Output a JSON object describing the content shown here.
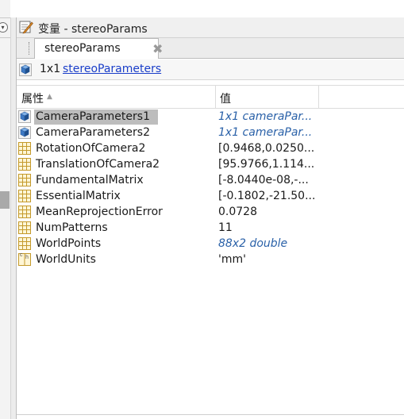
{
  "window": {
    "title": "变量 - stereoParams",
    "title_icon": "pencil-variable-icon"
  },
  "tabs": [
    {
      "label": "stereoParams",
      "close_glyph": "✖"
    }
  ],
  "summary": {
    "icon": "object-cube-icon",
    "size": "1x1",
    "class_name": "stereoParameters"
  },
  "table": {
    "headers": {
      "property": "属性",
      "value": "值"
    },
    "rows": [
      {
        "name": "CameraParameters1",
        "value": "1x1 cameraPar...",
        "icon": "object",
        "kind": "object",
        "selected": true
      },
      {
        "name": "CameraParameters2",
        "value": "1x1 cameraPar...",
        "icon": "object",
        "kind": "object",
        "selected": false
      },
      {
        "name": "RotationOfCamera2",
        "value": "[0.9468,0.0250...",
        "icon": "matrix",
        "kind": "value",
        "selected": false
      },
      {
        "name": "TranslationOfCamera2",
        "value": "[95.9766,1.114...",
        "icon": "matrix",
        "kind": "value",
        "selected": false
      },
      {
        "name": "FundamentalMatrix",
        "value": "[-8.0440e-08,-...",
        "icon": "matrix",
        "kind": "value",
        "selected": false
      },
      {
        "name": "EssentialMatrix",
        "value": "[-0.1802,-21.50...",
        "icon": "matrix",
        "kind": "value",
        "selected": false
      },
      {
        "name": "MeanReprojectionError",
        "value": "0.0728",
        "icon": "matrix",
        "kind": "value",
        "selected": false
      },
      {
        "name": "NumPatterns",
        "value": "11",
        "icon": "matrix",
        "kind": "value",
        "selected": false
      },
      {
        "name": "WorldPoints",
        "value": "88x2 double",
        "icon": "matrix",
        "kind": "object",
        "selected": false
      },
      {
        "name": "WorldUnits",
        "value": "'mm'",
        "icon": "char",
        "kind": "value",
        "selected": false
      }
    ]
  },
  "colors": {
    "link": "#1a3ec9",
    "object_value": "#2a61a8",
    "selection": "#bdbdbd"
  }
}
